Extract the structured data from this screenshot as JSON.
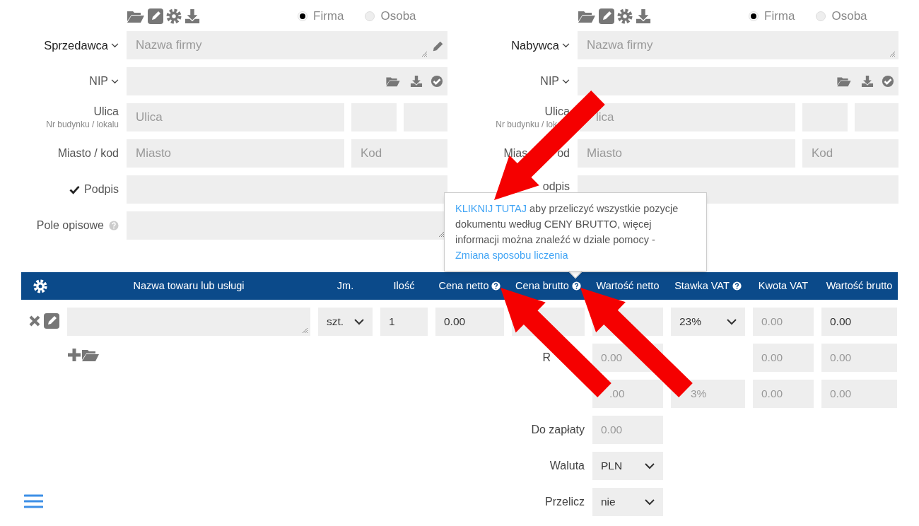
{
  "parties": [
    {
      "radios": [
        {
          "label": "Firma",
          "selected": true
        },
        {
          "label": "Osoba",
          "selected": false
        }
      ],
      "party_label": "Sprzedawca",
      "name_placeholder": "Nazwa firmy",
      "edit_icon": true,
      "nip_label": "NIP",
      "street_label": "Ulica",
      "street_sublabel": "Nr budynku / lokalu",
      "street_placeholder": "Ulica",
      "city_label": [
        "Miasto / kod"
      ],
      "city_placeholder": "Miasto",
      "postcode_placeholder": "Kod",
      "signature": {
        "label": "Podpis",
        "checked": true
      },
      "description_label": "Pole opisowe"
    },
    {
      "radios": [
        {
          "label": "Firma",
          "selected": true
        },
        {
          "label": "Osoba",
          "selected": false
        }
      ],
      "party_label": "Nabywca",
      "name_placeholder": "Nazwa firmy",
      "edit_icon": false,
      "nip_label": "NIP",
      "street_label": "Ulica",
      "street_sublabel": "Nr budynku / lok",
      "street_placeholder": "lica",
      "city_label": [
        "Mias",
        "od"
      ],
      "city_placeholder": "Miasto",
      "postcode_placeholder": "Kod",
      "signature": {
        "label": "odpis"
      }
    }
  ],
  "tooltip": [
    {
      "text": "KLIKNIJ TUTAJ",
      "link": true
    },
    {
      "text": " aby przeliczyć wszystkie pozycje dokumentu według CENY BRUTTO, więcej informacji można znaleźć w dziale pomocy - ",
      "link": false
    },
    {
      "text": "Zmiana sposobu liczenia",
      "link": true
    }
  ],
  "table": {
    "columns": [
      {
        "label": "Nazwa towaru lub usługi",
        "help": false
      },
      {
        "label": "Jm.",
        "help": false
      },
      {
        "label": "Ilość",
        "help": false
      },
      {
        "label": "Cena netto",
        "help": true
      },
      {
        "label": "Cena brutto",
        "help": true
      },
      {
        "label": "Wartość netto",
        "help": false
      },
      {
        "label": "Stawka VAT",
        "help": true
      },
      {
        "label": "Kwota VAT",
        "help": false
      },
      {
        "label": "Wartość brutto",
        "help": false
      }
    ],
    "items": [
      {
        "unit": "szt.",
        "quantity": "1",
        "net_price": "0.00",
        "vat_rate": "23%",
        "vat_amount": "0.00",
        "gross_value": "0.00"
      }
    ],
    "summary": [
      {
        "label": "R",
        "net": "0.00",
        "vat_amount": "0.00",
        "gross": "0.00"
      },
      {
        "net": ".00",
        "vat_rate": "3%",
        "vat_amount": "0.00",
        "gross": "0.00"
      }
    ]
  },
  "payment": [
    {
      "kind": "field",
      "label": "Do zapłaty",
      "value": "0.00"
    },
    {
      "kind": "select",
      "label": "Waluta",
      "value": "PLN"
    },
    {
      "kind": "select",
      "label": "Przelicz",
      "value": "nie"
    }
  ]
}
